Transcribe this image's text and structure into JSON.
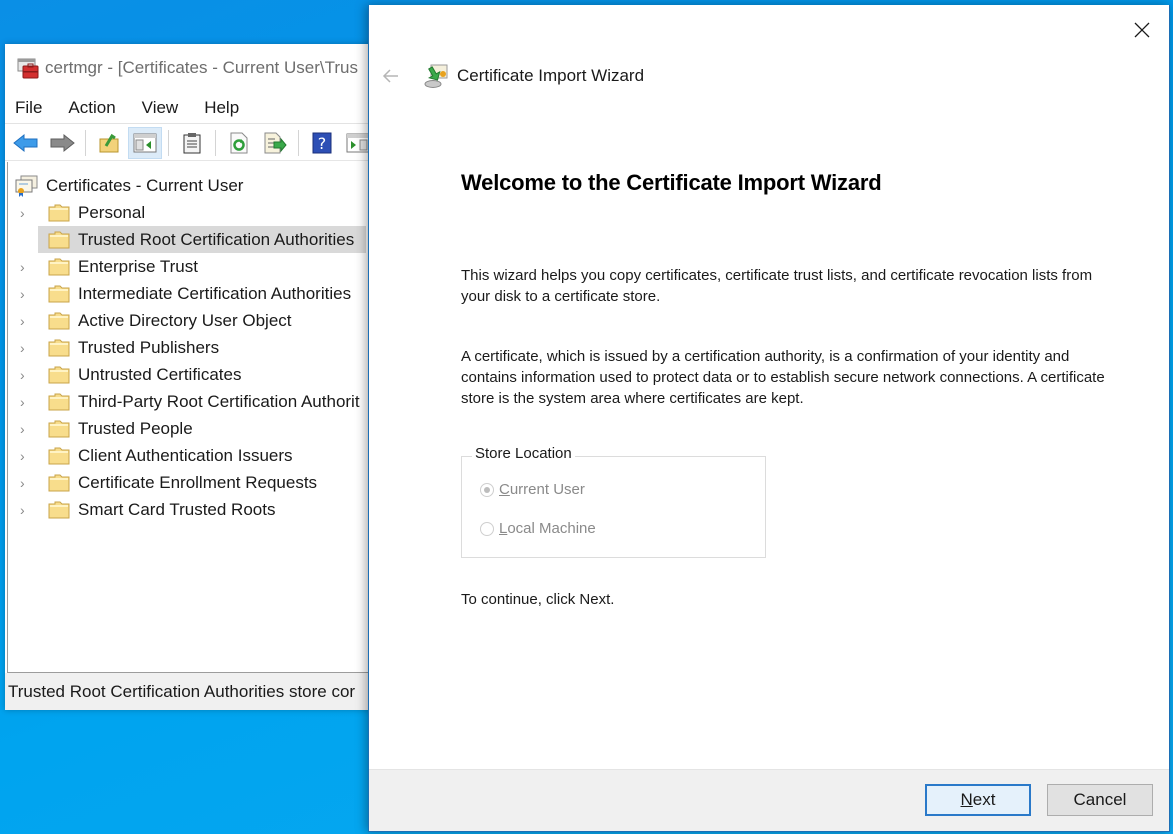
{
  "colors": {
    "desktop": "#0096e8",
    "selection": "#d9d9d9",
    "button_focus": "#2a79c9",
    "disabled_text": "#8a8a8a"
  },
  "mmc": {
    "title": "certmgr - [Certificates - Current User\\Trus",
    "app_icon": "toolbox-icon",
    "menu": [
      "File",
      "Action",
      "View",
      "Help"
    ],
    "toolbar": [
      {
        "name": "back-button",
        "icon": "arrow-left-icon"
      },
      {
        "name": "forward-button",
        "icon": "arrow-right-icon"
      },
      {
        "name": "up-one-level-button",
        "icon": "folder-up-icon"
      },
      {
        "name": "show-hide-console-tree-button",
        "icon": "console-tree-icon",
        "active": true
      },
      {
        "name": "properties-button",
        "icon": "clipboard-icon"
      },
      {
        "name": "refresh-button",
        "icon": "refresh-icon"
      },
      {
        "name": "export-list-button",
        "icon": "export-icon"
      },
      {
        "name": "help-button",
        "icon": "help-icon"
      },
      {
        "name": "show-action-pane-button",
        "icon": "action-pane-icon"
      }
    ],
    "tree": {
      "root": "Certificates - Current User",
      "items": [
        {
          "label": "Personal"
        },
        {
          "label": "Trusted Root Certification Authorities",
          "selected": true
        },
        {
          "label": "Enterprise Trust"
        },
        {
          "label": "Intermediate Certification Authorities"
        },
        {
          "label": "Active Directory User Object"
        },
        {
          "label": "Trusted Publishers"
        },
        {
          "label": "Untrusted Certificates"
        },
        {
          "label": "Third-Party Root Certification Authorit"
        },
        {
          "label": "Trusted People"
        },
        {
          "label": "Client Authentication Issuers"
        },
        {
          "label": "Certificate Enrollment Requests"
        },
        {
          "label": "Smart Card Trusted Roots"
        }
      ]
    },
    "status": "Trusted Root Certification Authorities store cor"
  },
  "wizard": {
    "header_title": "Certificate Import Wizard",
    "title": "Welcome to the Certificate Import Wizard",
    "paragraph1": "This wizard helps you copy certificates, certificate trust lists, and certificate revocation lists from your disk to a certificate store.",
    "paragraph2": "A certificate, which is issued by a certification authority, is a confirmation of your identity and contains information used to protect data or to establish secure network connections. A certificate store is the system area where certificates are kept.",
    "store_location": {
      "legend": "Store Location",
      "options": [
        {
          "accel": "C",
          "rest": "urrent User",
          "checked": true,
          "disabled": true
        },
        {
          "accel": "L",
          "rest": "ocal Machine",
          "checked": false,
          "disabled": true
        }
      ]
    },
    "continue_text": "To continue, click Next.",
    "buttons": {
      "next_accel": "N",
      "next_rest": "ext",
      "cancel": "Cancel"
    }
  }
}
